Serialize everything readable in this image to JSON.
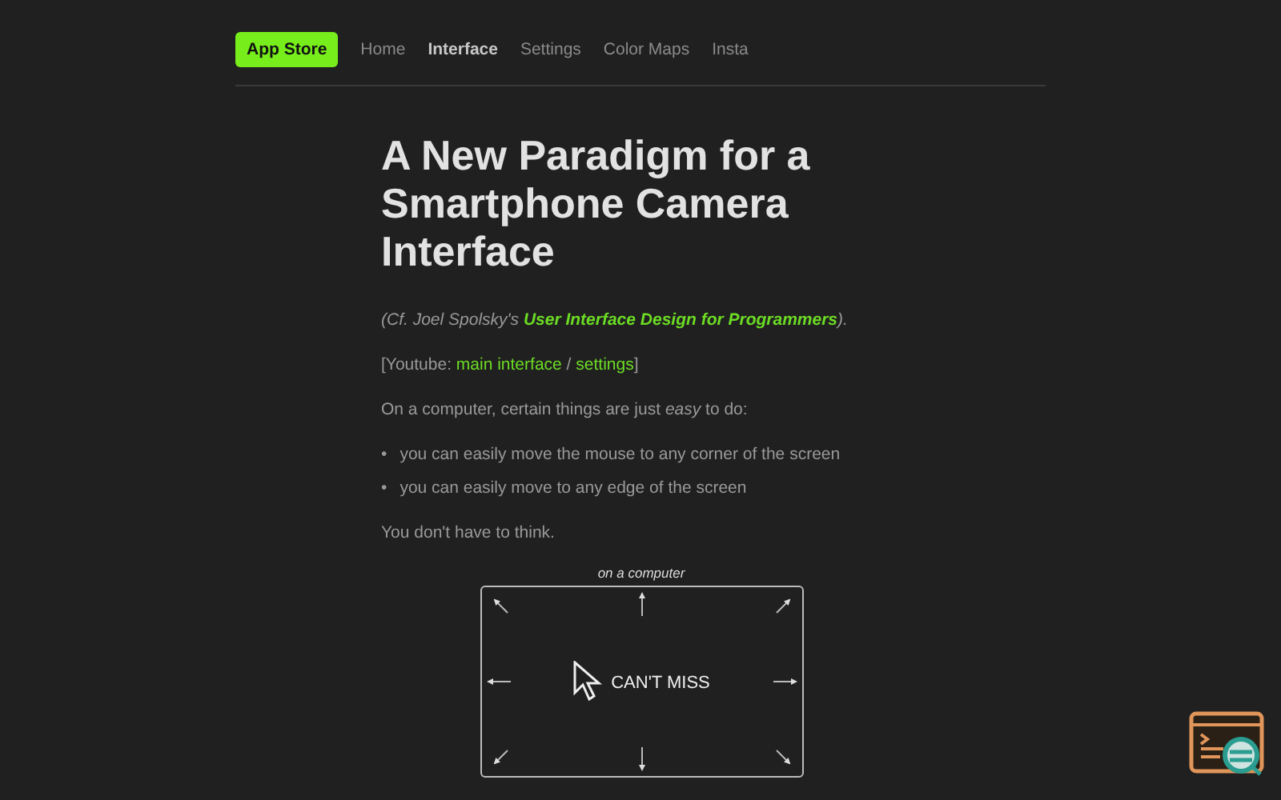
{
  "nav": {
    "brand": "App Store",
    "items": [
      {
        "label": "Home",
        "selected": false
      },
      {
        "label": "Interface",
        "selected": true
      },
      {
        "label": "Settings",
        "selected": false
      },
      {
        "label": "Color Maps",
        "selected": false
      },
      {
        "label": "Insta",
        "selected": false
      }
    ]
  },
  "article": {
    "title": "A New Paradigm for a Smartphone Camera Interface",
    "paragraphs": [
      {
        "kind": "citation",
        "parts": [
          {
            "text": "(Cf. Joel Spolsky's ",
            "link": false
          },
          {
            "text": "User Interface Design for Programmers",
            "link": true
          },
          {
            "text": ").",
            "link": false
          }
        ]
      },
      {
        "kind": "plain",
        "parts": [
          {
            "text": "[Youtube: ",
            "link": false
          },
          {
            "text": "main interface",
            "link": true
          },
          {
            "text": " / ",
            "link": false
          },
          {
            "text": "settings",
            "link": true
          },
          {
            "text": "]",
            "link": false
          }
        ]
      },
      {
        "kind": "plain",
        "parts": [
          {
            "text": "On a computer, certain things are just *easy* to do:",
            "link": false
          }
        ]
      }
    ],
    "bullets": [
      {
        "marker": "•",
        "text": "you can easily move the mouse to any corner of the screen"
      },
      {
        "marker": "•",
        "text": "you can easily move to any edge of the screen"
      }
    ],
    "closing": "You don't have to think.",
    "figure": {
      "caption": "on a computer",
      "label": "CAN'T MISS"
    }
  }
}
